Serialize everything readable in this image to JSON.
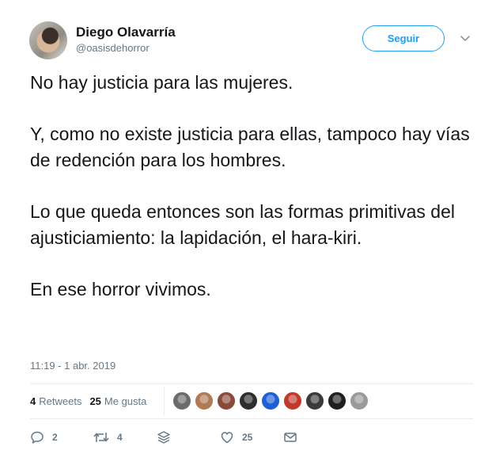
{
  "user": {
    "name": "Diego Olavarría",
    "handle": "@oasisdehorror"
  },
  "follow_label": "Seguir",
  "tweet": {
    "paragraphs": [
      "No hay justicia para las mujeres.",
      "Y, como no existe justicia para ellas, tampoco hay vías de redención para los hombres.",
      "Lo que queda entonces son las formas primitivas del ajusticiamiento: la lapidación, el hara-kiri.",
      "En ese horror vivimos."
    ],
    "timestamp": "11:19 - 1 abr. 2019"
  },
  "stats": {
    "retweets_count": "4",
    "retweets_label": "Retweets",
    "likes_count": "25",
    "likes_label": "Me gusta"
  },
  "liker_avatars": [
    {
      "color": "#6b6b6b"
    },
    {
      "color": "#b07a55"
    },
    {
      "color": "#8a4a3a"
    },
    {
      "color": "#2d2d2d"
    },
    {
      "color": "#1e5fd6"
    },
    {
      "color": "#c0392b"
    },
    {
      "color": "#3a3a3a"
    },
    {
      "color": "#1f1f1f"
    },
    {
      "color": "#9a9a9a"
    }
  ],
  "actions": {
    "replies": "2",
    "retweets": "4",
    "likes": "25"
  },
  "colors": {
    "accent": "#1da1f2",
    "muted": "#657786",
    "text": "#14171a"
  }
}
